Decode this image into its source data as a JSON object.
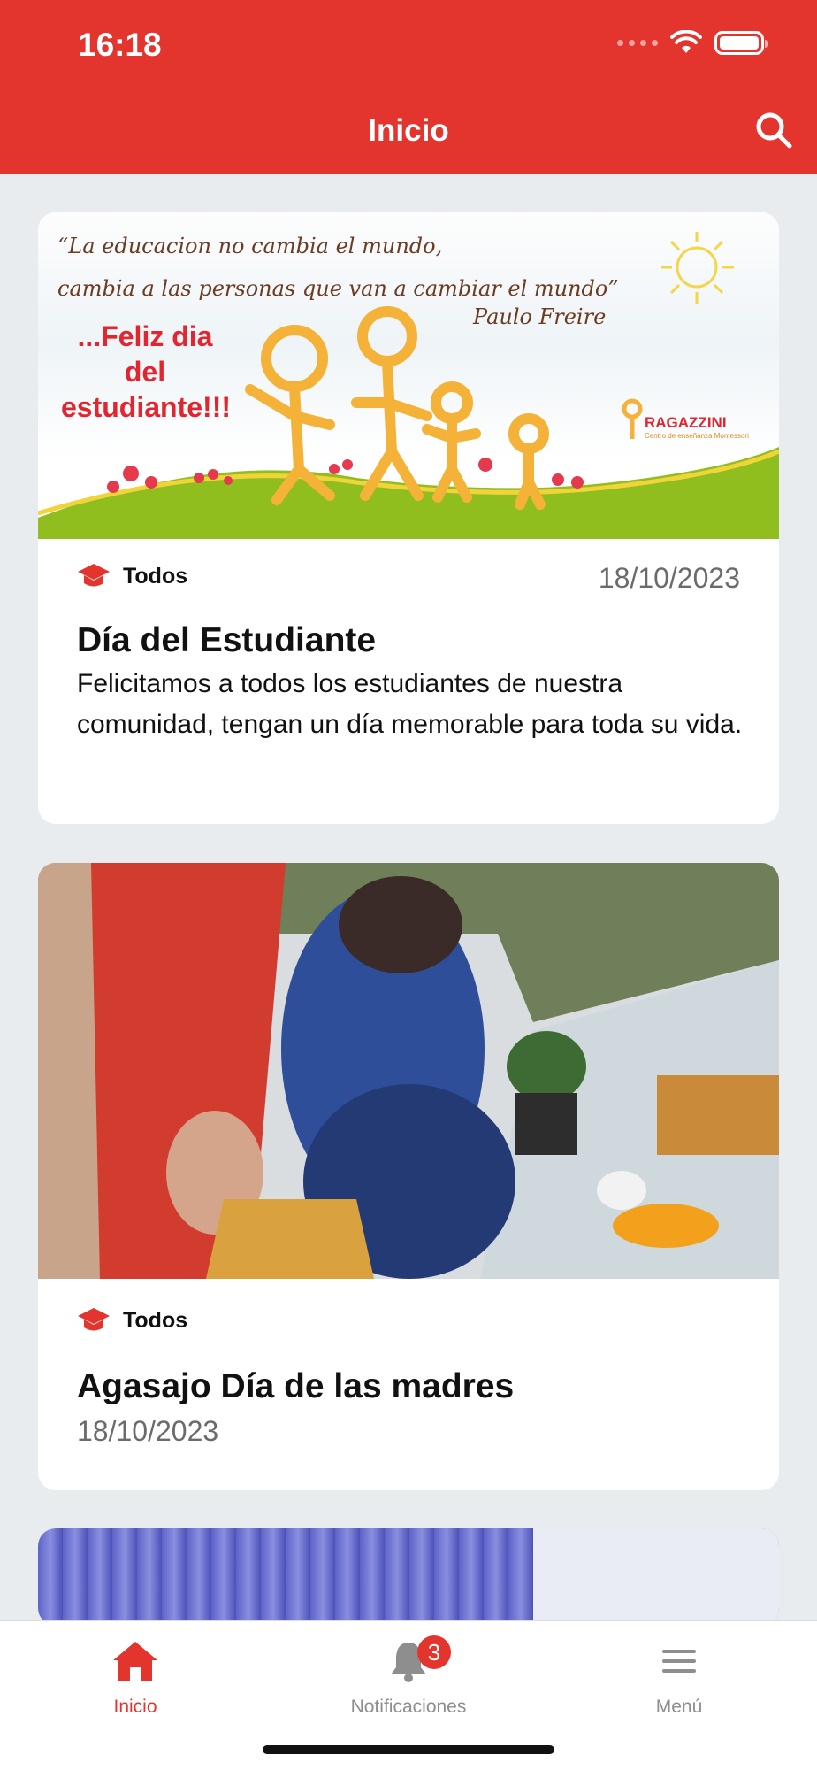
{
  "status_bar": {
    "time": "16:18"
  },
  "header": {
    "title": "Inicio"
  },
  "posts": [
    {
      "image": {
        "quote_line1": "“La educacion no cambia el mundo,",
        "quote_line2": "cambia a las personas que van a cambiar el mundo”",
        "quote_author": "Paulo Freire",
        "greeting_line1": "...Feliz dia",
        "greeting_line2": "del",
        "greeting_line3": "estudiante!!!",
        "logo_name": "RAGAZZINI",
        "logo_sub": "Centro de enseñanza Montessori"
      },
      "category": "Todos",
      "date": "18/10/2023",
      "title": "Día del Estudiante",
      "body": "Felicitamos a todos los estudiantes de nuestra comunidad, tengan un día memorable para toda su vida."
    },
    {
      "category": "Todos",
      "title": "Agasajo Día de las madres",
      "date": "18/10/2023"
    }
  ],
  "bottom_nav": {
    "items": [
      {
        "label": "Inicio",
        "icon": "home-icon",
        "active": true
      },
      {
        "label": "Notificaciones",
        "icon": "bell-icon",
        "badge": "3"
      },
      {
        "label": "Menú",
        "icon": "menu-icon"
      }
    ]
  },
  "colors": {
    "primary": "#e4342e",
    "background": "#e9ecef"
  }
}
